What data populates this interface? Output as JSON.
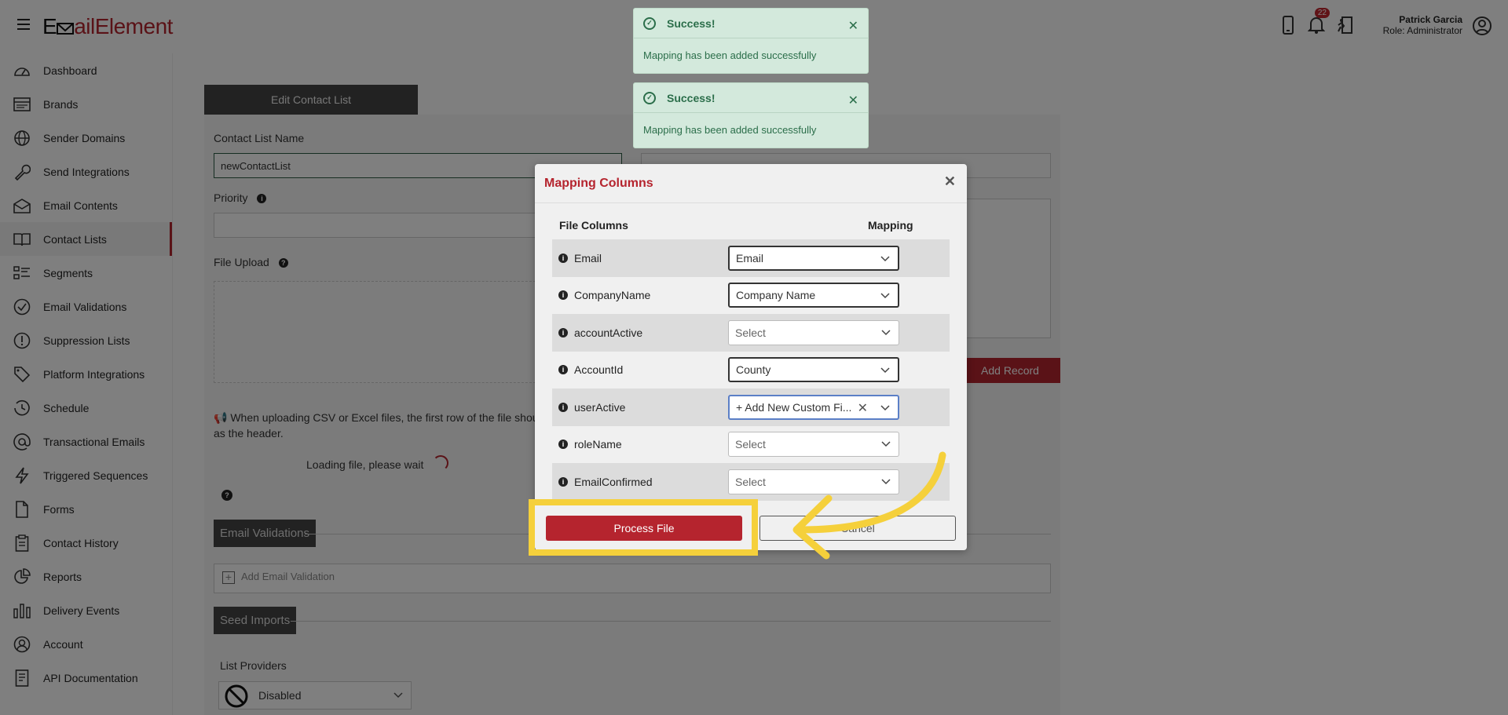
{
  "app": {
    "logo_prefix": "E",
    "logo_rest": "ailElement",
    "logo_symbol": "envelope-glyph"
  },
  "header": {
    "notification_count": "22",
    "user_name": "Patrick Garcia",
    "user_role": "Role: Administrator"
  },
  "sidebar": {
    "items": [
      {
        "label": "Dashboard",
        "icon": "dashboard-icon"
      },
      {
        "label": "Brands",
        "icon": "brands-icon"
      },
      {
        "label": "Sender Domains",
        "icon": "globe-icon"
      },
      {
        "label": "Send Integrations",
        "icon": "wrench-icon"
      },
      {
        "label": "Email Contents",
        "icon": "envelope-icon"
      },
      {
        "label": "Contact Lists",
        "icon": "book-icon",
        "active": true
      },
      {
        "label": "Segments",
        "icon": "segments-icon"
      },
      {
        "label": "Email Validations",
        "icon": "check-circle-icon"
      },
      {
        "label": "Suppression Lists",
        "icon": "alert-circle-icon"
      },
      {
        "label": "Platform Integrations",
        "icon": "tag-icon"
      },
      {
        "label": "Schedule",
        "icon": "history-icon"
      },
      {
        "label": "Transactional Emails",
        "icon": "at-icon"
      },
      {
        "label": "Triggered Sequences",
        "icon": "bolt-icon"
      },
      {
        "label": "Forms",
        "icon": "file-icon"
      },
      {
        "label": "Contact History",
        "icon": "clipboard-icon"
      },
      {
        "label": "Reports",
        "icon": "pie-chart-icon"
      },
      {
        "label": "Delivery Events",
        "icon": "bar-chart-icon"
      },
      {
        "label": "Account",
        "icon": "user-circle-icon"
      },
      {
        "label": "API Documentation",
        "icon": "document-icon"
      }
    ]
  },
  "form": {
    "tab_label": "Edit Contact List",
    "name_label": "Contact List Name",
    "name_value": "newContactList",
    "priority_label": "Priority",
    "file_upload_label": "File Upload",
    "notice": "When uploading CSV or Excel files, the first row of the file shou",
    "notice_line2": "as the header.",
    "loading_text": "Loading file, please wait",
    "add_record_label": "Add Record",
    "email_validations_label": "Email Validations",
    "add_email_validation_label": "Add Email Validation",
    "seed_imports_label": "Seed Imports",
    "list_providers_label": "List Providers",
    "list_providers_value": "Disabled"
  },
  "toasts": [
    {
      "title": "Success!",
      "message": "Mapping has been added successfully"
    },
    {
      "title": "Success!",
      "message": "Mapping has been added successfully"
    }
  ],
  "modal": {
    "title": "Mapping Columns",
    "col_file": "File Columns",
    "col_mapping": "Mapping",
    "rows": [
      {
        "column": "Email",
        "mapping": "Email",
        "state": "filled"
      },
      {
        "column": "CompanyName",
        "mapping": "Company Name",
        "state": "filled"
      },
      {
        "column": "accountActive",
        "mapping": "Select",
        "state": "empty"
      },
      {
        "column": "AccountId",
        "mapping": "County",
        "state": "filled"
      },
      {
        "column": "userActive",
        "mapping": "+ Add New Custom Fi...",
        "state": "focus"
      },
      {
        "column": "roleName",
        "mapping": "Select",
        "state": "empty"
      },
      {
        "column": "EmailConfirmed",
        "mapping": "Select",
        "state": "empty"
      }
    ],
    "process_label": "Process File",
    "cancel_label": "Cancel"
  },
  "colors": {
    "brand": "#b5242e",
    "toast_bg": "#d3e9dc",
    "highlight": "#f5d03b"
  }
}
